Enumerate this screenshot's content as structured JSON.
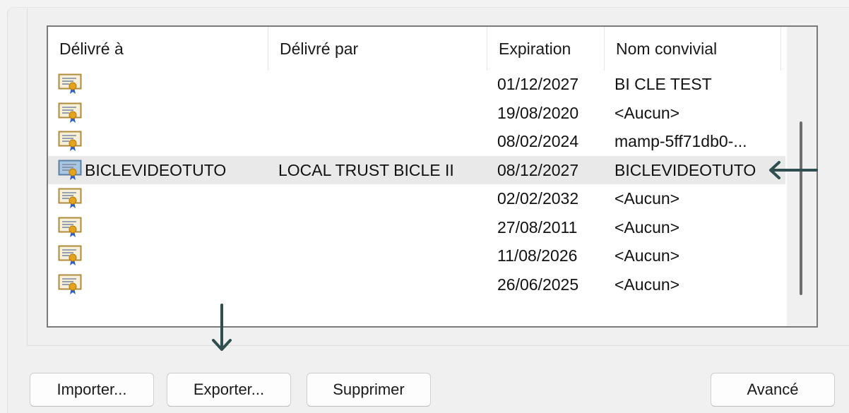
{
  "columns": [
    "Délivré à",
    "Délivré par",
    "Expiration",
    "Nom convivial"
  ],
  "rows": [
    {
      "issued_to": "",
      "issued_by": "",
      "expiration": "01/12/2027",
      "friendly_name": "BI CLE TEST",
      "selected": false
    },
    {
      "issued_to": "",
      "issued_by": "",
      "expiration": "19/08/2020",
      "friendly_name": "<Aucun>",
      "selected": false
    },
    {
      "issued_to": "",
      "issued_by": "",
      "expiration": "08/02/2024",
      "friendly_name": "mamp-5ff71db0-...",
      "selected": false
    },
    {
      "issued_to": "BICLEVIDEOTUTO",
      "issued_by": "LOCAL TRUST BICLE II",
      "expiration": "08/12/2027",
      "friendly_name": "BICLEVIDEOTUTO",
      "selected": true
    },
    {
      "issued_to": "",
      "issued_by": "",
      "expiration": "02/02/2032",
      "friendly_name": "<Aucun>",
      "selected": false
    },
    {
      "issued_to": "",
      "issued_by": "",
      "expiration": "27/08/2011",
      "friendly_name": "<Aucun>",
      "selected": false
    },
    {
      "issued_to": "",
      "issued_by": "",
      "expiration": "11/08/2026",
      "friendly_name": "<Aucun>",
      "selected": false
    },
    {
      "issued_to": "",
      "issued_by": "",
      "expiration": "26/06/2025",
      "friendly_name": "<Aucun>",
      "selected": false
    }
  ],
  "buttons": {
    "import": "Importer...",
    "export": "Exporter...",
    "delete": "Supprimer",
    "advanced": "Avancé"
  },
  "icons": {
    "row_icon": "certificate-icon",
    "annotation_left": "arrow-left-icon",
    "annotation_down": "arrow-down-icon"
  },
  "colors": {
    "annotation_arrow": "#2f4f4f",
    "selected_row": "#e9e9e9",
    "list_border": "#7a7a7a"
  }
}
